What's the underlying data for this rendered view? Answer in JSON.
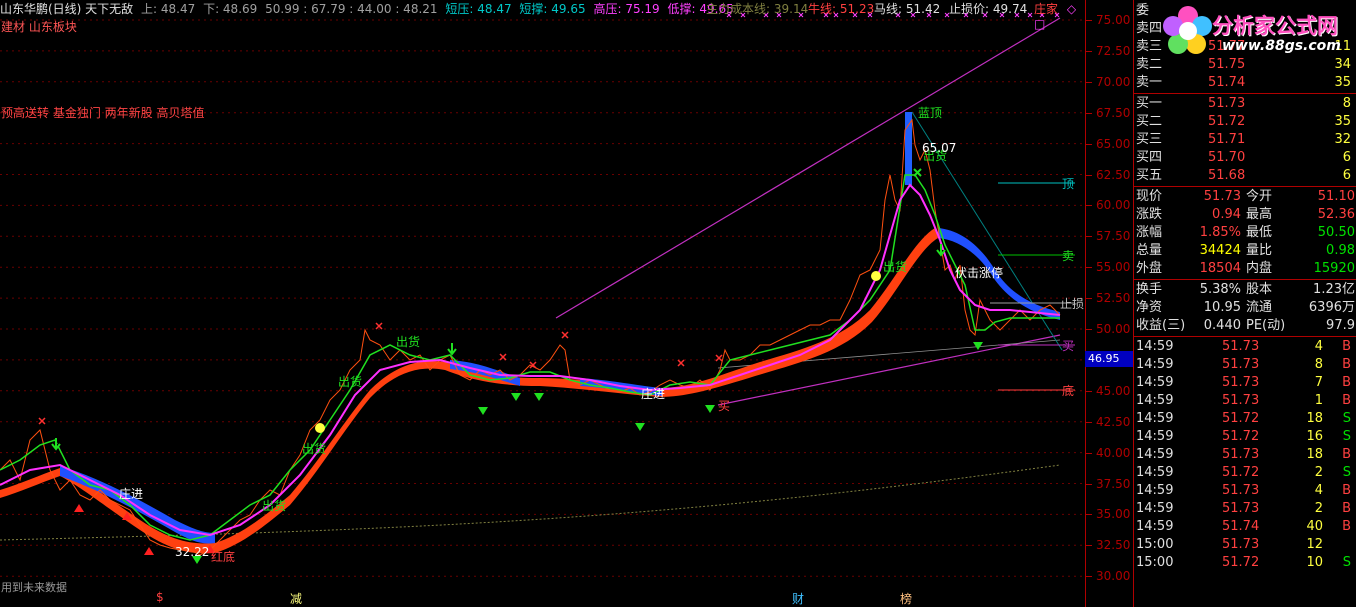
{
  "header": {
    "stock_name": "山东华鹏(日线) 天下无敌",
    "up_label": "上: 48.47",
    "down_label": "下: 48.69",
    "values": "50.99 : 67.79 : 44.00 : 48.21",
    "short_press": "短压: 48.47",
    "short_support": "短撑: 49.65",
    "high_press": "高压: 75.19",
    "low_support": "低撑: 49.65",
    "main_cost": "主力成本线: 39.14",
    "bull_line": "牛线: 51.23",
    "horse_line": "马线: 51.42",
    "stop_loss": "止损价: 49.74",
    "dealer": "庄家",
    "diamond": "◇",
    "square": "□",
    "colors": {
      "white": "#e0e0e0",
      "cyan": "#00c8c8",
      "magenta": "#ff40ff",
      "gray": "#a0a0a0",
      "red": "#ff4040"
    }
  },
  "subtitle": "建材 山东板块",
  "tags": "预高送转 基金独门 两年新股 高贝塔值",
  "future_note": "用到未来数据",
  "bottom_marks": [
    "$",
    "减",
    "财",
    "榜"
  ],
  "price_axis": {
    "ticks": [
      "75.00",
      "72.50",
      "70.00",
      "67.50",
      "65.00",
      "62.50",
      "60.00",
      "57.50",
      "55.00",
      "52.50",
      "50.00",
      "47.50",
      "45.00",
      "42.50",
      "40.00",
      "37.50",
      "35.00",
      "32.50",
      "30.00"
    ],
    "current": "46.95"
  },
  "annotations": {
    "chu_huo": "出货",
    "zhuang_jin": "庄进",
    "hong_di": "红底",
    "lan_ding": "蓝顶",
    "fu_ji_zhang_ting": "伏击涨停",
    "low_price": "32.22",
    "high_price": "65.07",
    "mai": "买",
    "ding": "顶",
    "sell": "卖",
    "bottom": "底",
    "zhi_sun": "止损"
  },
  "logo": {
    "name": "分析家公式网",
    "url": "www.88gs.com"
  },
  "quote": {
    "wei_label": "委",
    "asks": [
      {
        "label": "卖五",
        "price": "",
        "vol": ""
      },
      {
        "label": "卖四",
        "price": "",
        "vol": ""
      },
      {
        "label": "卖三",
        "price": "51.77",
        "vol": "11"
      },
      {
        "label": "卖二",
        "price": "51.75",
        "vol": "34"
      },
      {
        "label": "卖一",
        "price": "51.74",
        "vol": "35"
      }
    ],
    "bids": [
      {
        "label": "买一",
        "price": "51.73",
        "vol": "8"
      },
      {
        "label": "买二",
        "price": "51.72",
        "vol": "35"
      },
      {
        "label": "买三",
        "price": "51.71",
        "vol": "32"
      },
      {
        "label": "买四",
        "price": "51.70",
        "vol": "6"
      },
      {
        "label": "买五",
        "price": "51.68",
        "vol": "6"
      }
    ],
    "stats": [
      {
        "l1": "现价",
        "v1": "51.73",
        "l2": "今开",
        "v2": "51.10",
        "c1": "#ff4040",
        "c2": "#ff4040"
      },
      {
        "l1": "涨跌",
        "v1": "0.94",
        "l2": "最高",
        "v2": "52.36",
        "c1": "#ff4040",
        "c2": "#ff4040"
      },
      {
        "l1": "涨幅",
        "v1": "1.85%",
        "l2": "最低",
        "v2": "50.50",
        "c1": "#ff4040",
        "c2": "#00e000"
      },
      {
        "l1": "总量",
        "v1": "34424",
        "l2": "量比",
        "v2": "0.98",
        "c1": "#ffff00",
        "c2": "#00e000"
      },
      {
        "l1": "外盘",
        "v1": "18504",
        "l2": "内盘",
        "v2": "15920",
        "c1": "#ff4040",
        "c2": "#00e000"
      }
    ],
    "stats2": [
      {
        "l1": "换手",
        "v1": "5.38%",
        "l2": "股本",
        "v2": "1.23亿"
      },
      {
        "l1": "净资",
        "v1": "10.95",
        "l2": "流通",
        "v2": "6396万"
      },
      {
        "l1": "收益(三)",
        "v1": "0.440",
        "l2": "PE(动)",
        "v2": "97.9"
      }
    ],
    "ticks": [
      {
        "time": "14:59",
        "price": "51.73",
        "vol": "4",
        "side": "B"
      },
      {
        "time": "14:59",
        "price": "51.73",
        "vol": "8",
        "side": "B"
      },
      {
        "time": "14:59",
        "price": "51.73",
        "vol": "7",
        "side": "B"
      },
      {
        "time": "14:59",
        "price": "51.73",
        "vol": "1",
        "side": "B"
      },
      {
        "time": "14:59",
        "price": "51.72",
        "vol": "18",
        "side": "S"
      },
      {
        "time": "14:59",
        "price": "51.72",
        "vol": "16",
        "side": "S"
      },
      {
        "time": "14:59",
        "price": "51.73",
        "vol": "18",
        "side": "B"
      },
      {
        "time": "14:59",
        "price": "51.72",
        "vol": "2",
        "side": "S"
      },
      {
        "time": "14:59",
        "price": "51.73",
        "vol": "4",
        "side": "B"
      },
      {
        "time": "14:59",
        "price": "51.73",
        "vol": "2",
        "side": "B"
      },
      {
        "time": "14:59",
        "price": "51.74",
        "vol": "40",
        "side": "B"
      },
      {
        "time": "15:00",
        "price": "51.73",
        "vol": "12",
        "side": ""
      },
      {
        "time": "15:00",
        "price": "51.72",
        "vol": "10",
        "side": "S"
      }
    ]
  }
}
